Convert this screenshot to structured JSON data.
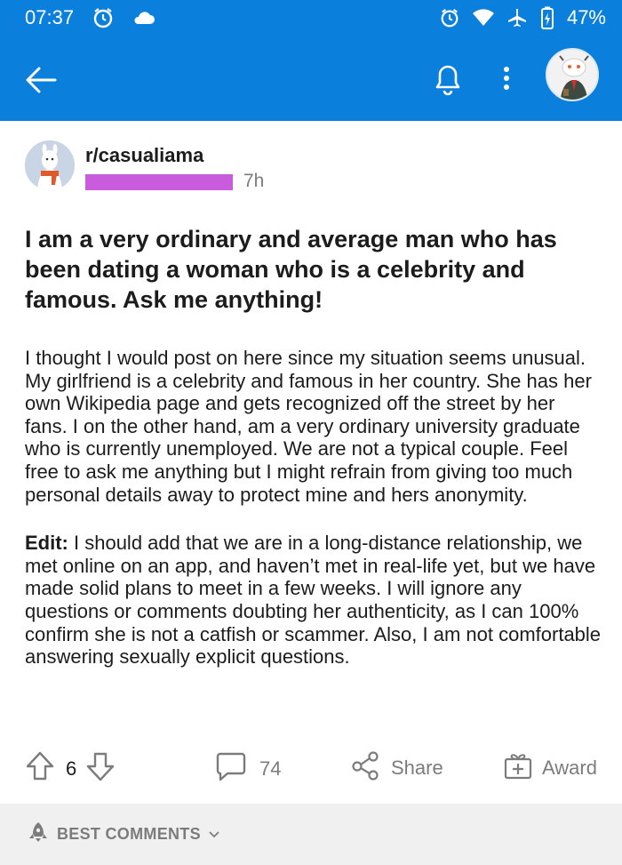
{
  "status_bar": {
    "time": "07:37",
    "battery": "47%"
  },
  "app_bar": {
    "icons": [
      "back-arrow-icon",
      "bell-icon",
      "more-vertical-icon",
      "avatar"
    ]
  },
  "post": {
    "subreddit": "r/casualiama",
    "age": "7h",
    "title": "I am a very ordinary and average man who has been dating a woman who is a celebrity and famous. Ask me anything!",
    "body": "I thought I would post on here since my situation seems unusual. My girlfriend is a celebrity and famous in her country. She has her own Wikipedia page and gets recognized off the street by her fans. I on the other hand, am a very ordinary university graduate who is currently unemployed. We are not a typical couple. Feel free to ask me anything but I might refrain from giving too much personal details away to protect mine and hers anonymity.",
    "edit_label": "Edit:",
    "edit_text": " I should add that we are in a long-distance relationship, we met online on an app, and haven’t met in real-life yet, but we have made solid plans to meet in a few weeks. I will ignore any questions or comments doubting her authenticity, as I can 100% confirm she is not a catfish or scammer. Also, I am not comfortable answering sexually explicit questions."
  },
  "actions": {
    "vote_count": "6",
    "comment_count": "74",
    "share_label": "Share",
    "award_label": "Award"
  },
  "comments_sort": {
    "label": "BEST COMMENTS"
  },
  "colors": {
    "header_blue": "#0a7fdc",
    "redaction": "#c95bdd",
    "muted": "#7c7c7c"
  }
}
